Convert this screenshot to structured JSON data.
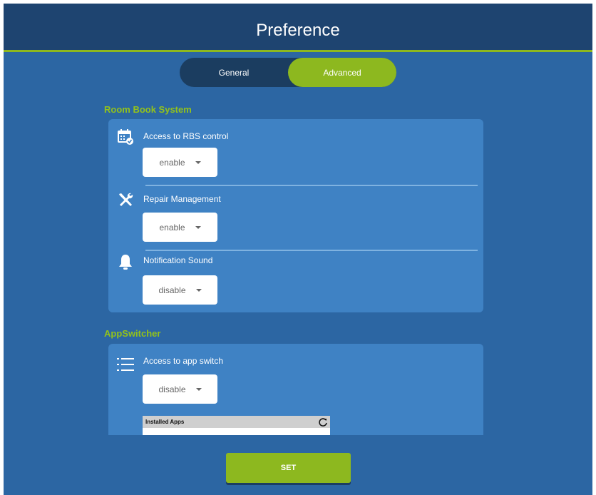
{
  "header": {
    "title": "Preference"
  },
  "tabs": [
    {
      "label": "General",
      "active": false
    },
    {
      "label": "Advanced",
      "active": true
    }
  ],
  "room_book_system": {
    "title": "Room Book System",
    "items": [
      {
        "icon": "calendar-check-icon",
        "label": "Access to RBS control",
        "value": "enable"
      },
      {
        "icon": "tools-icon",
        "label": "Repair Management",
        "value": "enable"
      },
      {
        "icon": "bell-icon",
        "label": "Notification Sound",
        "value": "disable"
      }
    ]
  },
  "app_switcher": {
    "title": "AppSwitcher",
    "items": [
      {
        "icon": "list-icon",
        "label": "Access to app switch",
        "value": "disable"
      }
    ],
    "installed_apps": {
      "label": "Installed Apps",
      "icon": "refresh-icon"
    }
  },
  "set_button": {
    "label": "SET"
  },
  "colors": {
    "accent": "#8db81f",
    "header": "#1e4470",
    "background": "#2c66a3",
    "card": "#3f82c4"
  }
}
